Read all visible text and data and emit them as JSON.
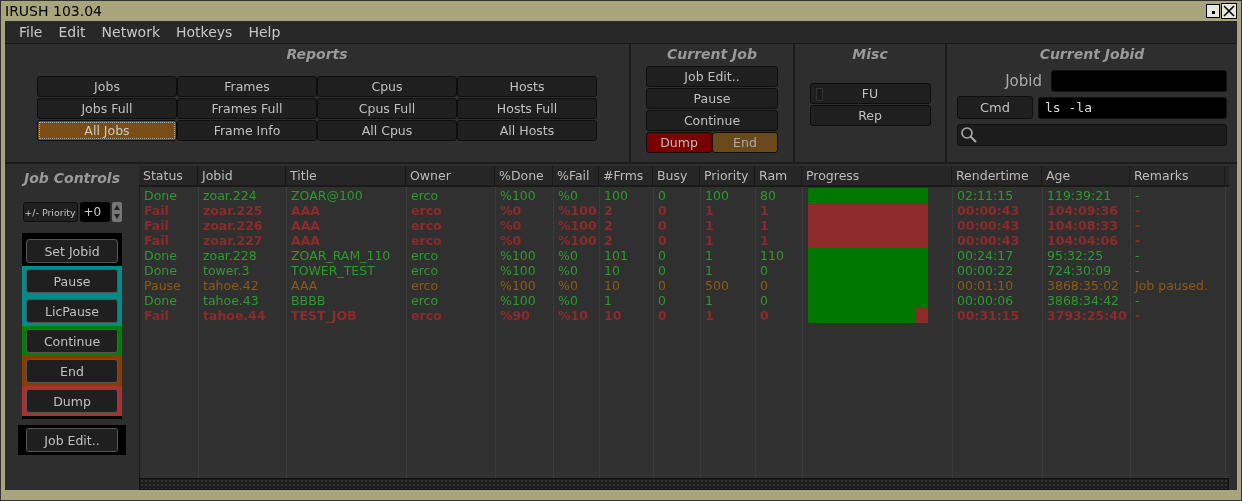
{
  "window": {
    "title": "IRUSH 103.04"
  },
  "menu": [
    "File",
    "Edit",
    "Network",
    "Hotkeys",
    "Help"
  ],
  "reports": {
    "title": "Reports",
    "buttons": [
      {
        "label": "Jobs",
        "selected": false
      },
      {
        "label": "Frames",
        "selected": false
      },
      {
        "label": "Cpus",
        "selected": false
      },
      {
        "label": "Hosts",
        "selected": false
      },
      {
        "label": "Jobs Full",
        "selected": false
      },
      {
        "label": "Frames Full",
        "selected": false
      },
      {
        "label": "Cpus Full",
        "selected": false
      },
      {
        "label": "Hosts Full",
        "selected": false
      },
      {
        "label": "All Jobs",
        "selected": true
      },
      {
        "label": "Frame Info",
        "selected": false
      },
      {
        "label": "All Cpus",
        "selected": false
      },
      {
        "label": "All Hosts",
        "selected": false
      }
    ]
  },
  "current_job": {
    "title": "Current Job",
    "buttons": [
      {
        "label": "Job Edit..",
        "kind": "plain"
      },
      {
        "label": "Pause",
        "kind": "plain"
      },
      {
        "label": "Continue",
        "kind": "plain"
      },
      {
        "label": "Dump",
        "kind": "dump"
      },
      {
        "label": "End",
        "kind": "end"
      }
    ]
  },
  "misc": {
    "title": "Misc",
    "buttons": [
      {
        "label": "FU",
        "kind": "toggle",
        "on": false
      },
      {
        "label": "Rep",
        "kind": "plain"
      }
    ]
  },
  "current_jobid": {
    "title": "Current Jobid",
    "jobid_label": "Jobid",
    "cmd_button": "Cmd",
    "cmd_value": "ls -la"
  },
  "job_controls": {
    "title": "Job Controls",
    "priority_button": "+/- Priority",
    "priority_value": "+0",
    "buttons": [
      {
        "label": "Set Jobid",
        "color": "#000000"
      },
      {
        "label": "Pause",
        "color": "#008b8b"
      },
      {
        "label": "LicPause",
        "color": "#008b8b"
      },
      {
        "label": "Continue",
        "color": "#008000"
      },
      {
        "label": "End",
        "color": "#8b3a00"
      },
      {
        "label": "Dump",
        "color": "#a83232"
      }
    ],
    "job_edit": "Job Edit.."
  },
  "table": {
    "columns": [
      "Status",
      "Jobid",
      "Title",
      "Owner",
      "%Done",
      "%Fail",
      "#Frms",
      "Busy",
      "Priority",
      "Ram",
      "Progress",
      "Rendertime",
      "Age",
      "Remarks"
    ],
    "rows": [
      {
        "kind": "done",
        "level": 1,
        "cells": [
          "Done",
          "zoar.224",
          "ZOAR@100",
          "erco",
          "%100",
          "%0",
          "100",
          "0",
          "100",
          "80",
          "",
          "02:11:15",
          "119:39:21",
          "-"
        ]
      },
      {
        "kind": "fail",
        "level": 0,
        "cells": [
          "Fail",
          "zoar.225",
          "AAA",
          "erco",
          "%0",
          "%100",
          "2",
          "0",
          "1",
          "1",
          "",
          "00:00:43",
          "104:09:36",
          "-"
        ]
      },
      {
        "kind": "fail",
        "level": 0,
        "cells": [
          "Fail",
          "zoar.226",
          "AAA",
          "erco",
          "%0",
          "%100",
          "2",
          "0",
          "1",
          "1",
          "",
          "00:00:43",
          "104:08:33",
          "-"
        ]
      },
      {
        "kind": "fail",
        "level": 0,
        "cells": [
          "Fail",
          "zoar.227",
          "AAA",
          "erco",
          "%0",
          "%100",
          "2",
          "0",
          "1",
          "1",
          "",
          "00:00:43",
          "104:04:06",
          "-"
        ]
      },
      {
        "kind": "done",
        "level": 1,
        "cells": [
          "Done",
          "zoar.228",
          "ZOAR_RAM_110",
          "erco",
          "%100",
          "%0",
          "101",
          "0",
          "1",
          "110",
          "",
          "00:24:17",
          "95:32:25",
          "-"
        ]
      },
      {
        "kind": "done",
        "level": 1,
        "cells": [
          "Done",
          "tower.3",
          "TOWER_TEST",
          "erco",
          "%100",
          "%0",
          "10",
          "0",
          "1",
          "0",
          "",
          "00:00:22",
          "724:30:09",
          "-"
        ]
      },
      {
        "kind": "pause",
        "level": 1,
        "cells": [
          "Pause",
          "tahoe.42",
          "AAA",
          "erco",
          "%100",
          "%0",
          "10",
          "0",
          "500",
          "0",
          "",
          "00:01:10",
          "3868:35:02",
          "Job paused."
        ]
      },
      {
        "kind": "done",
        "level": 1,
        "cells": [
          "Done",
          "tahoe.43",
          "BBBB",
          "erco",
          "%100",
          "%0",
          "1",
          "0",
          "1",
          "0",
          "",
          "00:00:06",
          "3868:34:42",
          "-"
        ]
      },
      {
        "kind": "fail",
        "level": 0.9,
        "cells": [
          "Fail",
          "tahoe.44",
          "TEST_JOB",
          "erco",
          "%90",
          "%10",
          "10",
          "0",
          "1",
          "0",
          "",
          "00:31:15",
          "3793:25:40",
          "-"
        ]
      }
    ]
  }
}
